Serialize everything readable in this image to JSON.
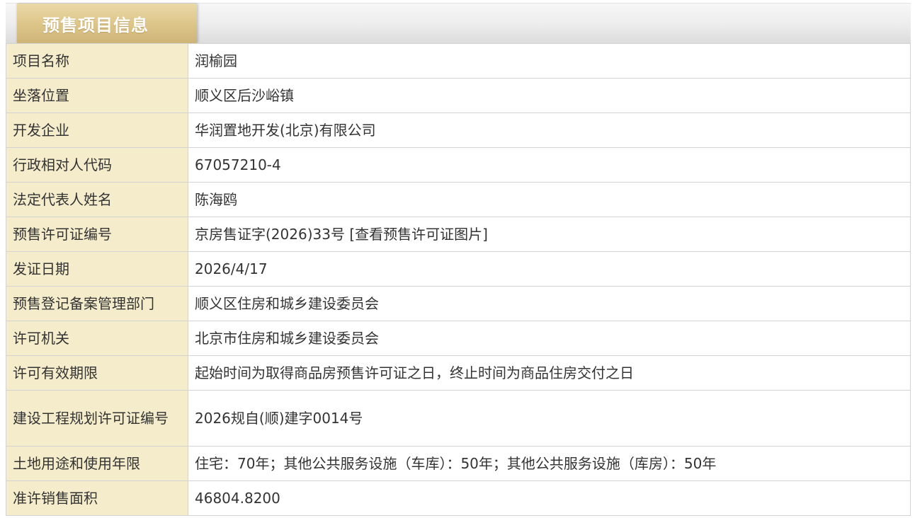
{
  "section": {
    "title": "预售项目信息"
  },
  "rows": [
    {
      "label": "项目名称",
      "value": "润榆园"
    },
    {
      "label": "坐落位置",
      "value": "顺义区后沙峪镇"
    },
    {
      "label": "开发企业",
      "value": "华润置地开发(北京)有限公司"
    },
    {
      "label": "行政相对人代码",
      "value": "67057210-4"
    },
    {
      "label": "法定代表人姓名",
      "value": "陈海鸥"
    },
    {
      "label": "预售许可证编号",
      "value": "京房售证字(2026)33号",
      "link": "[查看预售许可证图片]"
    },
    {
      "label": "发证日期",
      "value": "2026/4/17"
    },
    {
      "label": "预售登记备案管理部门",
      "value": "顺义区住房和城乡建设委员会"
    },
    {
      "label": "许可机关",
      "value": "北京市住房和城乡建设委员会"
    },
    {
      "label": "许可有效期限",
      "value": "起始时间为取得商品房预售许可证之日，终止时间为商品住房交付之日"
    },
    {
      "label": "建设工程规划许可证编号",
      "value": "2026规自(顺)建字0014号"
    },
    {
      "label": "土地用途和使用年限",
      "value": "住宅：70年；其他公共服务设施（车库）：50年；其他公共服务设施（库房）：50年"
    },
    {
      "label": "准许销售面积",
      "value": "46804.8200"
    }
  ]
}
